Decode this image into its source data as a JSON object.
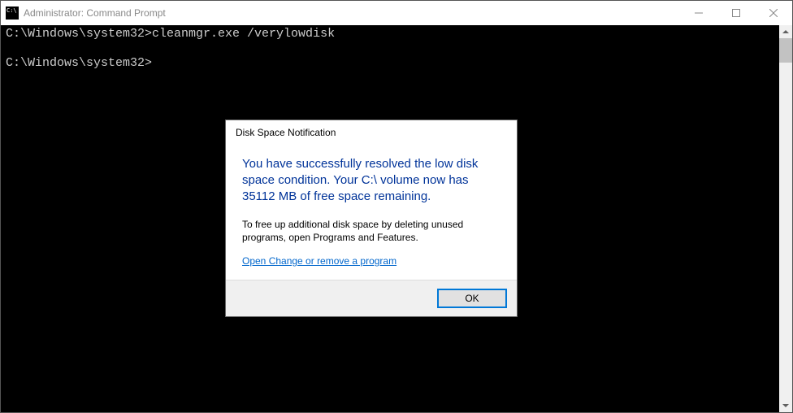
{
  "window": {
    "title": "Administrator: Command Prompt"
  },
  "terminal": {
    "line1_prompt": "C:\\Windows\\system32>",
    "line1_cmd": "cleanmgr.exe /verylowdisk",
    "line2_prompt": "C:\\Windows\\system32>"
  },
  "dialog": {
    "title": "Disk Space Notification",
    "message": "You have successfully resolved the low disk space condition. Your C:\\ volume now has 35112 MB of free space remaining.",
    "subtext": "To free up additional disk space by deleting unused programs, open Programs and Features.",
    "link": "Open Change or remove a program",
    "ok": "OK"
  }
}
